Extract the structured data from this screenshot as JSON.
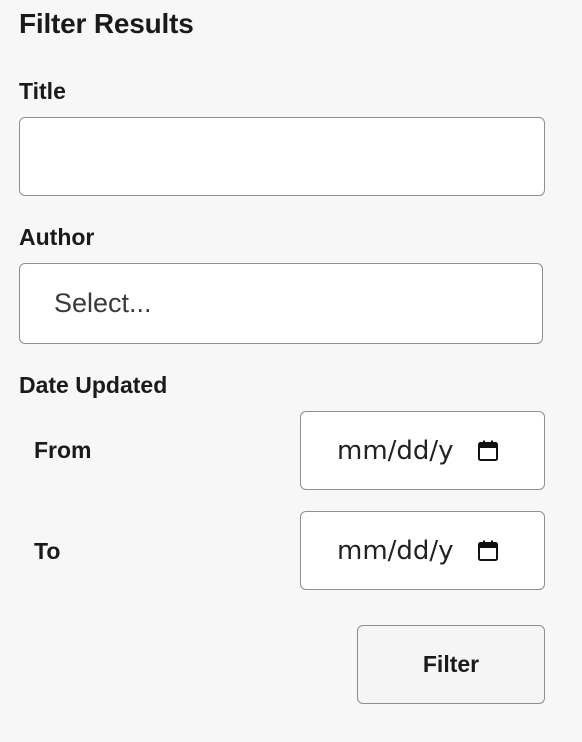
{
  "panel": {
    "heading": "Filter Results"
  },
  "title_filter": {
    "label": "Title",
    "value": "",
    "placeholder": ""
  },
  "author_filter": {
    "label": "Author",
    "selected": "Select..."
  },
  "date_filter": {
    "label": "Date Updated",
    "from_label": "From",
    "from_value": "mm/dd/y",
    "to_label": "To",
    "to_value": "mm/dd/y",
    "icon": "calendar-icon"
  },
  "actions": {
    "filter_label": "Filter"
  }
}
